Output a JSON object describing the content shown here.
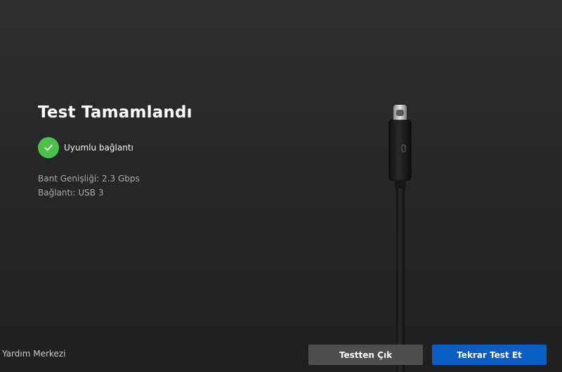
{
  "result": {
    "title": "Test Tamamlandı",
    "status_label": "Uyumlu bağlantı",
    "status_icon": "check-icon",
    "status_color": "#4cc24a",
    "bandwidth_text": "Bant Genişliği: 2.3 Gbps",
    "connection_text": "Bağlantı: USB 3"
  },
  "footer": {
    "help_label": "Yardım Merkezi",
    "exit_button_label": "Testten Çık",
    "retry_button_label": "Tekrar Test Et",
    "retry_button_color": "#0a5fc4"
  },
  "illustration": {
    "icon": "usb-c-cable-icon"
  }
}
